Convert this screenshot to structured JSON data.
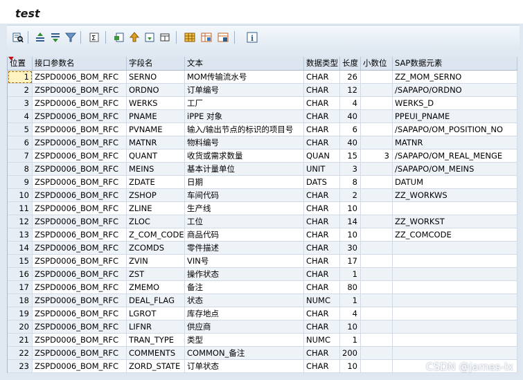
{
  "window": {
    "title": "test"
  },
  "toolbar": {
    "icons": [
      "details-icon",
      "sort-ascending-icon",
      "sort-descending-icon",
      "filter-icon",
      "sum-icon",
      "export-icon",
      "print-icon",
      "local-file-icon",
      "view-icon",
      "layout-icon",
      "choose-layout-icon",
      "save-layout-icon",
      "info-icon"
    ]
  },
  "table": {
    "headers": [
      "位置",
      "接口参数名",
      "字段名",
      "文本",
      "数据类型",
      "长度",
      "小数位",
      "SAP数据元素"
    ],
    "rows": [
      [
        "1",
        "ZSPD0006_BOM_RFC",
        "SERNO",
        "MOM传输流水号",
        "CHAR",
        "26",
        "",
        "ZZ_MOM_SERNO"
      ],
      [
        "2",
        "ZSPD0006_BOM_RFC",
        "ORDNO",
        "订单编号",
        "CHAR",
        "12",
        "",
        "/SAPAPO/ORDNO"
      ],
      [
        "3",
        "ZSPD0006_BOM_RFC",
        "WERKS",
        "工厂",
        "CHAR",
        "4",
        "",
        "WERKS_D"
      ],
      [
        "4",
        "ZSPD0006_BOM_RFC",
        "PNAME",
        "iPPE 对象",
        "CHAR",
        "40",
        "",
        "PPEUI_PNAME"
      ],
      [
        "5",
        "ZSPD0006_BOM_RFC",
        "PVNAME",
        "输入/输出节点的标识的项目号",
        "CHAR",
        "6",
        "",
        "/SAPAPO/OM_POSITION_NO"
      ],
      [
        "6",
        "ZSPD0006_BOM_RFC",
        "MATNR",
        "物料编号",
        "CHAR",
        "40",
        "",
        "MATNR"
      ],
      [
        "7",
        "ZSPD0006_BOM_RFC",
        "QUANT",
        "收货或需求数量",
        "QUAN",
        "15",
        "3",
        "/SAPAPO/OM_REAL_MENGE"
      ],
      [
        "8",
        "ZSPD0006_BOM_RFC",
        "MEINS",
        "基本计量单位",
        "UNIT",
        "3",
        "",
        "/SAPAPO/OM_MEINS"
      ],
      [
        "9",
        "ZSPD0006_BOM_RFC",
        "ZDATE",
        "日期",
        "DATS",
        "8",
        "",
        "DATUM"
      ],
      [
        "10",
        "ZSPD0006_BOM_RFC",
        "ZSHOP",
        "车间代码",
        "CHAR",
        "2",
        "",
        "ZZ_WORKWS"
      ],
      [
        "11",
        "ZSPD0006_BOM_RFC",
        "ZLINE",
        "生产线",
        "CHAR",
        "10",
        "",
        ""
      ],
      [
        "12",
        "ZSPD0006_BOM_RFC",
        "ZLOC",
        "工位",
        "CHAR",
        "14",
        "",
        "ZZ_WORKST"
      ],
      [
        "13",
        "ZSPD0006_BOM_RFC",
        "Z_COM_CODE",
        "商品代码",
        "CHAR",
        "10",
        "",
        "ZZ_COMCODE"
      ],
      [
        "14",
        "ZSPD0006_BOM_RFC",
        "ZCOMDS",
        "零件描述",
        "CHAR",
        "30",
        "",
        ""
      ],
      [
        "15",
        "ZSPD0006_BOM_RFC",
        "ZVIN",
        "VIN号",
        "CHAR",
        "17",
        "",
        ""
      ],
      [
        "16",
        "ZSPD0006_BOM_RFC",
        "ZST",
        "操作状态",
        "CHAR",
        "1",
        "",
        ""
      ],
      [
        "17",
        "ZSPD0006_BOM_RFC",
        "ZMEMO",
        "备注",
        "CHAR",
        "80",
        "",
        ""
      ],
      [
        "18",
        "ZSPD0006_BOM_RFC",
        "DEAL_FLAG",
        "状态",
        "NUMC",
        "1",
        "",
        ""
      ],
      [
        "19",
        "ZSPD0006_BOM_RFC",
        "LGROT",
        "库存地点",
        "CHAR",
        "4",
        "",
        ""
      ],
      [
        "20",
        "ZSPD0006_BOM_RFC",
        "LIFNR",
        "供应商",
        "CHAR",
        "10",
        "",
        ""
      ],
      [
        "21",
        "ZSPD0006_BOM_RFC",
        "TRAN_TYPE",
        "类型",
        "NUMC",
        "1",
        "",
        ""
      ],
      [
        "22",
        "ZSPD0006_BOM_RFC",
        "COMMENTS",
        "COMMON_备注",
        "CHAR",
        "200",
        "",
        ""
      ],
      [
        "23",
        "ZSPD0006_BOM_RFC",
        "ZORD_STATE",
        "订单状态",
        "CHAR",
        "10",
        "",
        ""
      ]
    ]
  },
  "watermark": "CSDN @james-lx"
}
